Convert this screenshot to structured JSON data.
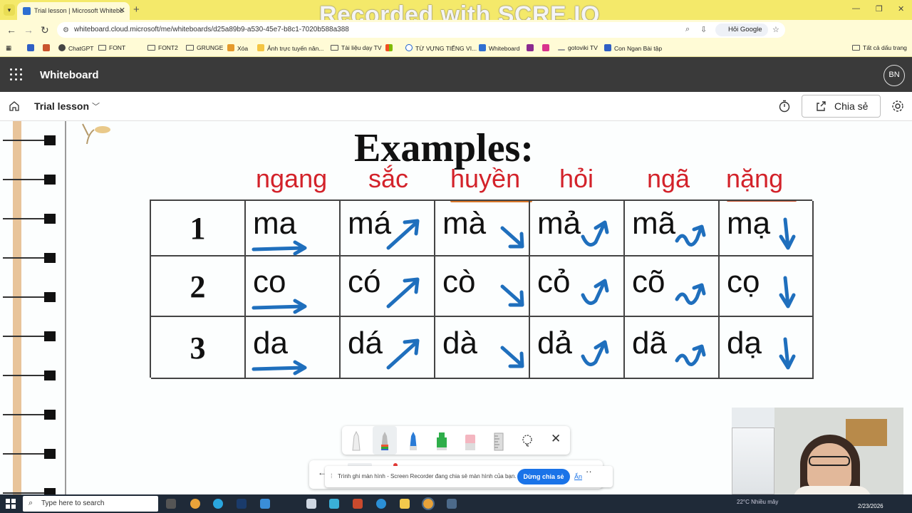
{
  "browser": {
    "tab_title": "Trial lesson | Microsoft Whitebo",
    "watermark": "Recorded with SCRE.IO",
    "url": "whiteboard.cloud.microsoft/me/whiteboards/d25a89b9-a530-45e7-b8c1-7020b588a388",
    "ask_google": "Hỏi Google",
    "bookmarks": [
      "ChatGPT",
      "FONT",
      "FONT2",
      "GRUNGE",
      "Xóa",
      "Ảnh trực tuyến nân...",
      "Tài liệu dạy TV",
      "TỪ VỰNG TIẾNG VI...",
      "Whiteboard",
      "gotoviki TV",
      "Con Ngan Bài tập"
    ],
    "all_bookmarks": "Tất cả dấu trang"
  },
  "app": {
    "title": "Whiteboard",
    "avatar_initials": "BN",
    "board_name": "Trial lesson",
    "share_label": "Chia sẻ"
  },
  "board": {
    "heading": "Examples:",
    "tones": [
      "ngang",
      "sắc",
      "huyền",
      "hỏi",
      "ngã",
      "nặng"
    ],
    "rows": [
      {
        "num": "1",
        "syllables": [
          "ma",
          "má",
          "mà",
          "mả",
          "mã",
          "mạ"
        ]
      },
      {
        "num": "2",
        "syllables": [
          "co",
          "có",
          "cò",
          "cỏ",
          "cõ",
          "cọ"
        ]
      },
      {
        "num": "3",
        "syllables": [
          "da",
          "dá",
          "dà",
          "dả",
          "dã",
          "dạ"
        ]
      }
    ],
    "accent_red": "#d3222a",
    "arrow_blue": "#1f6fbd"
  },
  "screen_share": {
    "notice": "Trình ghi màn hình - Screen Recorder đang chia sẻ màn hình của bạn.",
    "stop_label": "Dừng chia sẻ",
    "hide_label": "Ẩn"
  },
  "taskbar": {
    "search_placeholder": "Type here to search",
    "weather": "22°C Nhiều mây",
    "date": "2/23/2026"
  }
}
